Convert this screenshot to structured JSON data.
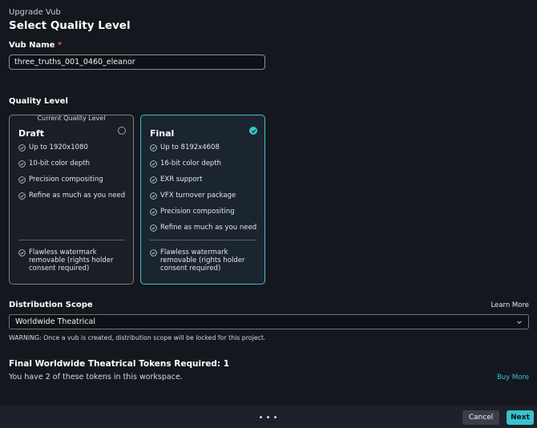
{
  "header": {
    "subtitle": "Upgrade Vub",
    "title": "Select Quality Level"
  },
  "vub_name": {
    "label": "Vub Name",
    "required_mark": "*",
    "value": "three_truths_001_0460_eleanor"
  },
  "quality": {
    "label": "Quality Level",
    "cards": [
      {
        "tag": "Current Quality Level",
        "title": "Draft",
        "selected": false,
        "features": [
          "Up to 1920x1080",
          "10-bit color depth",
          "Precision compositing",
          "Refine as much as you need"
        ],
        "extra": "Flawless watermark removable (rights holder consent required)"
      },
      {
        "tag": "",
        "title": "Final",
        "selected": true,
        "features": [
          "Up to 8192x4608",
          "16-bit color depth",
          "EXR support",
          "VFX turnover package",
          "Precision compositing",
          "Refine as much as you need"
        ],
        "extra": "Flawless watermark removable (rights holder consent required)"
      }
    ]
  },
  "distribution": {
    "label": "Distribution Scope",
    "learn_more": "Learn More",
    "selected": "Worldwide Theatrical",
    "warning": "WARNING: Once a vub is created, distribution scope will be locked for this project."
  },
  "tokens": {
    "heading": "Final Worldwide Theatrical Tokens Required: 1",
    "info": "You have 2 of these tokens in this workspace.",
    "buy_more": "Buy More"
  },
  "footer": {
    "cancel": "Cancel",
    "next": "Next",
    "steps": 3,
    "current_step": 1
  },
  "colors": {
    "accent": "#38c2cf",
    "background": "#14171d"
  }
}
